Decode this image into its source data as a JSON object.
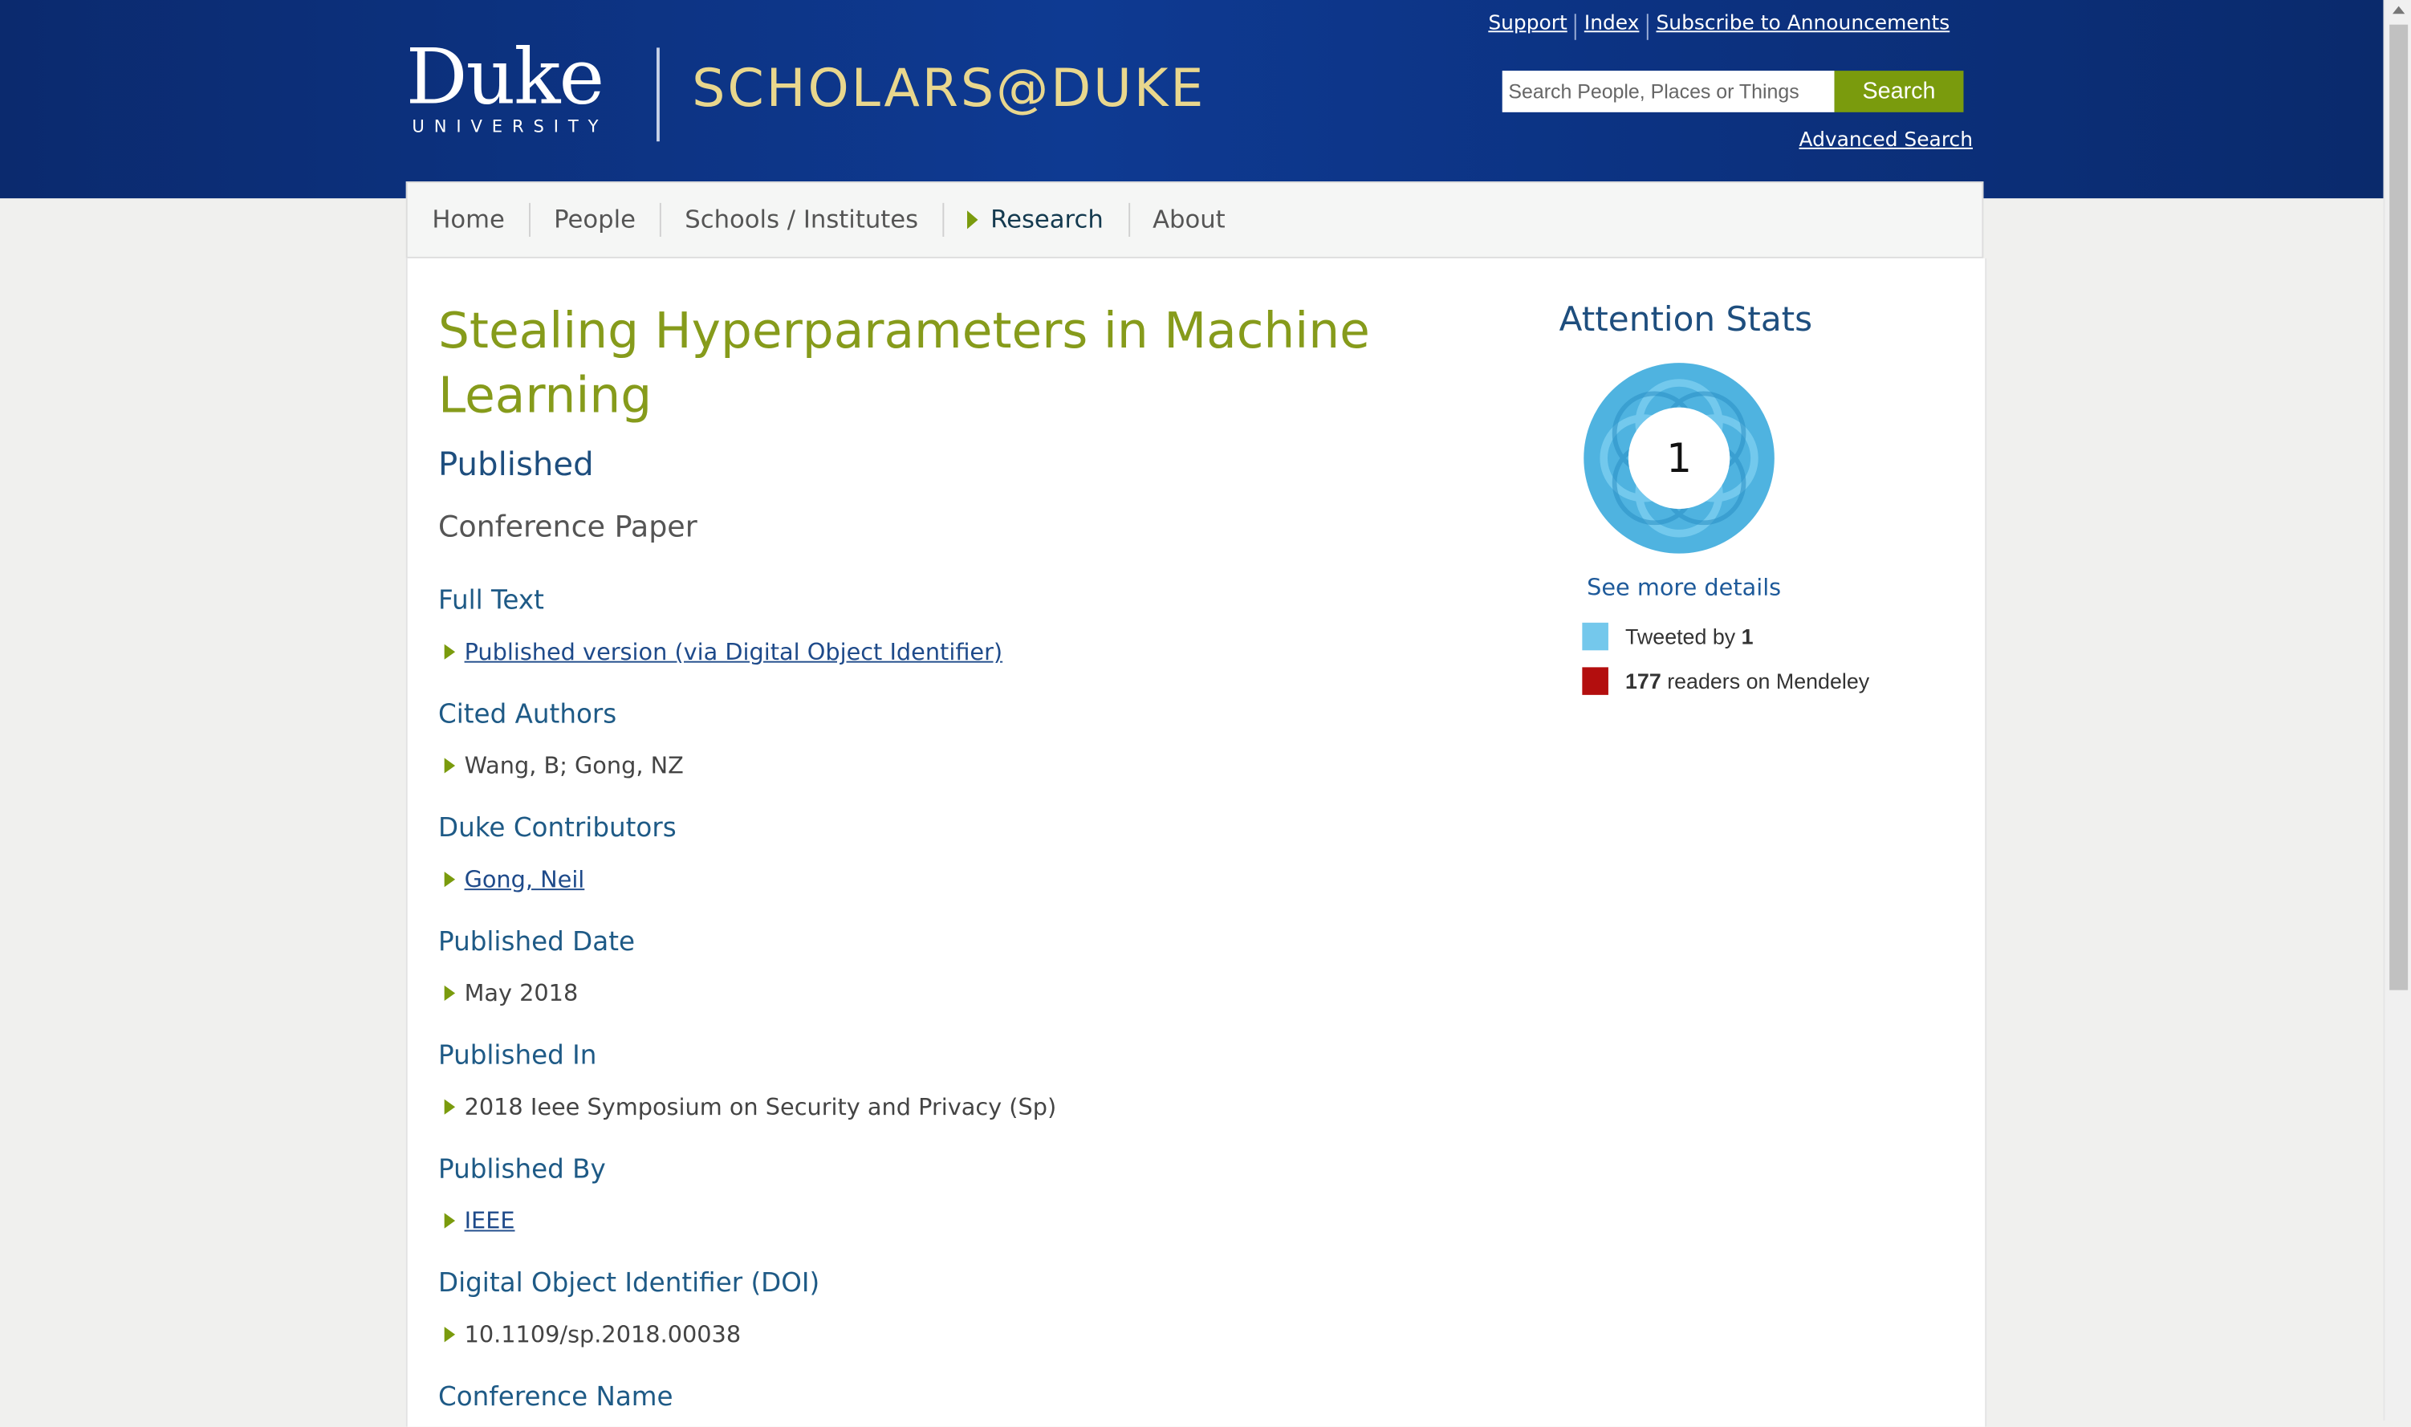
{
  "header": {
    "logo_main": "Duke",
    "logo_sub": "UNIVERSITY",
    "site_name": "SCHOLARS@DUKE",
    "top_links": [
      "Support",
      "Index",
      "Subscribe to Announcements"
    ],
    "search_placeholder": "Search People, Places or Things",
    "search_button": "Search",
    "advanced_search": "Advanced Search"
  },
  "nav": {
    "items": [
      "Home",
      "People",
      "Schools / Institutes",
      "Research",
      "About"
    ],
    "active": "Research"
  },
  "publication": {
    "title": "Stealing Hyperparameters in Machine Learning",
    "status": "Published",
    "type": "Conference Paper",
    "sections": [
      {
        "label": "Full Text",
        "value": "Published version (via Digital Object Identifier)",
        "link": true
      },
      {
        "label": "Cited Authors",
        "value": "Wang, B; Gong, NZ",
        "link": false
      },
      {
        "label": "Duke Contributors",
        "value": "Gong, Neil",
        "link": true
      },
      {
        "label": "Published Date",
        "value": "May 2018",
        "link": false
      },
      {
        "label": "Published In",
        "value": "2018 Ieee Symposium on Security and Privacy (Sp)",
        "link": false
      },
      {
        "label": "Published By",
        "value": "IEEE",
        "link": true
      },
      {
        "label": "Digital Object Identifier (DOI)",
        "value": "10.1109/sp.2018.00038",
        "link": false
      },
      {
        "label": "Conference Name",
        "value": "",
        "link": false
      }
    ]
  },
  "attention": {
    "title": "Attention Stats",
    "score": "1",
    "see_more": "See more details",
    "rows": [
      {
        "color": "#74c8ec",
        "prefix": "Tweeted by ",
        "count": "1",
        "suffix": ""
      },
      {
        "color": "#b30e0e",
        "prefix": "",
        "count": "177",
        "suffix": " readers on Mendeley"
      }
    ]
  },
  "colors": {
    "header_bg": "#0e3a92",
    "accent_green": "#7a9b0d",
    "title_green": "#869b1b",
    "scholars_gold": "#e9d78d",
    "link_blue": "#1e4a8a"
  }
}
